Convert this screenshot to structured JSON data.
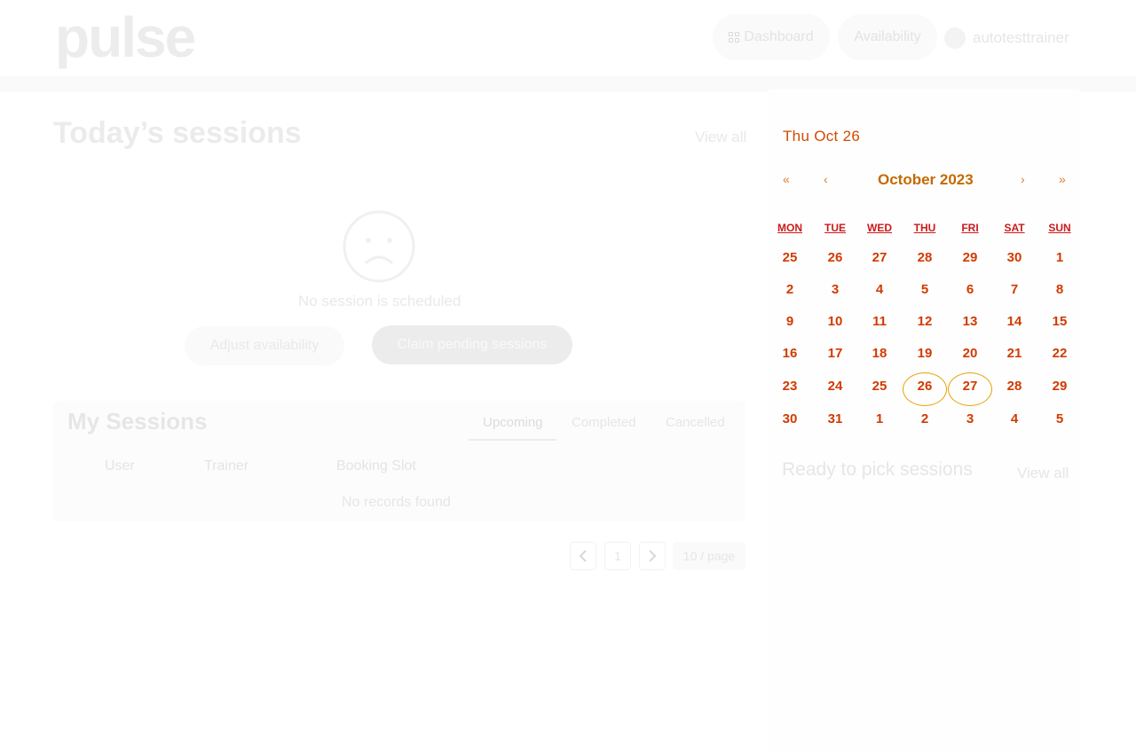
{
  "app": {
    "logo": "pulse"
  },
  "nav": {
    "dashboard_label": "Dashboard",
    "availability_label": "Availability",
    "username": "autotesttrainer"
  },
  "today": {
    "title": "Today’s sessions",
    "view_all": "View all",
    "empty_message": "No session is scheduled",
    "adjust_button": "Adjust availability",
    "claim_button": "Claim pending sessions"
  },
  "my_sessions": {
    "title": "My Sessions",
    "tabs": [
      "Upcoming",
      "Completed",
      "Cancelled"
    ],
    "active_tab": "Upcoming",
    "columns": [
      "User",
      "Trainer",
      "Booking Slot"
    ],
    "empty_message": "No records found"
  },
  "pagination": {
    "current_page": "1",
    "page_size": "10 / page"
  },
  "calendar": {
    "header": "Thu Oct 26",
    "month_label": "October 2023",
    "prev_year": "«",
    "prev_month": "‹",
    "next_month": "›",
    "next_year": "»",
    "weekdays": [
      "MON",
      "TUE",
      "WED",
      "THU",
      "FRI",
      "SAT",
      "SUN"
    ],
    "weeks": [
      [
        "25",
        "26",
        "27",
        "28",
        "29",
        "30",
        "1"
      ],
      [
        "2",
        "3",
        "4",
        "5",
        "6",
        "7",
        "8"
      ],
      [
        "9",
        "10",
        "11",
        "12",
        "13",
        "14",
        "15"
      ],
      [
        "16",
        "17",
        "18",
        "19",
        "20",
        "21",
        "22"
      ],
      [
        "23",
        "24",
        "25",
        "26",
        "27",
        "28",
        "29"
      ],
      [
        "30",
        "31",
        "1",
        "2",
        "3",
        "4",
        "5"
      ]
    ],
    "highlighted_days": [
      "26",
      "27"
    ],
    "accent_color": "#d23a00",
    "highlight_color": "#e6a200"
  },
  "ready": {
    "title": "Ready to pick sessions",
    "view_all": "View all"
  },
  "icons": {
    "dashboard": "grid-icon",
    "empty_state": "sad-face-icon",
    "prev_page": "chevron-left-icon",
    "next_page": "chevron-right-icon"
  }
}
